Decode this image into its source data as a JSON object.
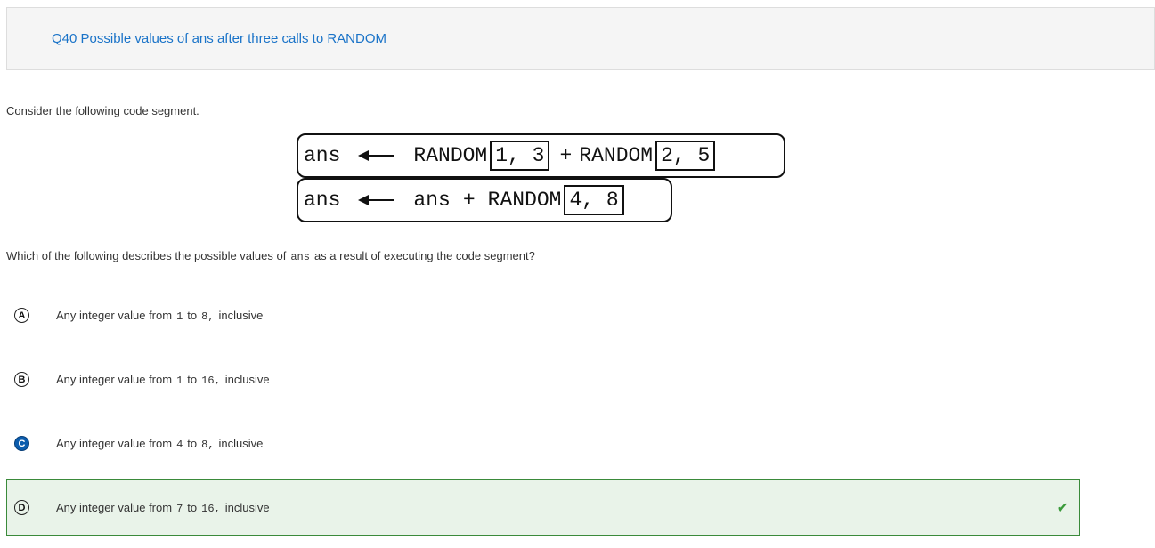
{
  "header": {
    "title": "Q40 Possible values of ans after three calls to RANDOM"
  },
  "intro": "Consider the following code segment.",
  "code": {
    "line1": {
      "var": "ans",
      "call1": "RANDOM",
      "args1": "1, 3",
      "op": "+",
      "call2": "RANDOM",
      "args2": "2, 5"
    },
    "line2": {
      "var": "ans",
      "expr": "ans",
      "op": "+",
      "call": "RANDOM",
      "args": "4, 8"
    }
  },
  "question": {
    "before": "Which of the following describes the possible values of",
    "code": "ans",
    "after": "as a result of executing the code segment?"
  },
  "options": [
    {
      "letter": "A",
      "prefix": "Any integer value from",
      "low": "1",
      "to": "to",
      "high": "8,",
      "suffix": "inclusive"
    },
    {
      "letter": "B",
      "prefix": "Any integer value from",
      "low": "1",
      "to": "to",
      "high": "16,",
      "suffix": "inclusive"
    },
    {
      "letter": "C",
      "prefix": "Any integer value from",
      "low": "4",
      "to": "to",
      "high": "8,",
      "suffix": "inclusive"
    },
    {
      "letter": "D",
      "prefix": "Any integer value from",
      "low": "7",
      "to": "to",
      "high": "16,",
      "suffix": "inclusive"
    }
  ],
  "selected": "C",
  "correct": "D"
}
